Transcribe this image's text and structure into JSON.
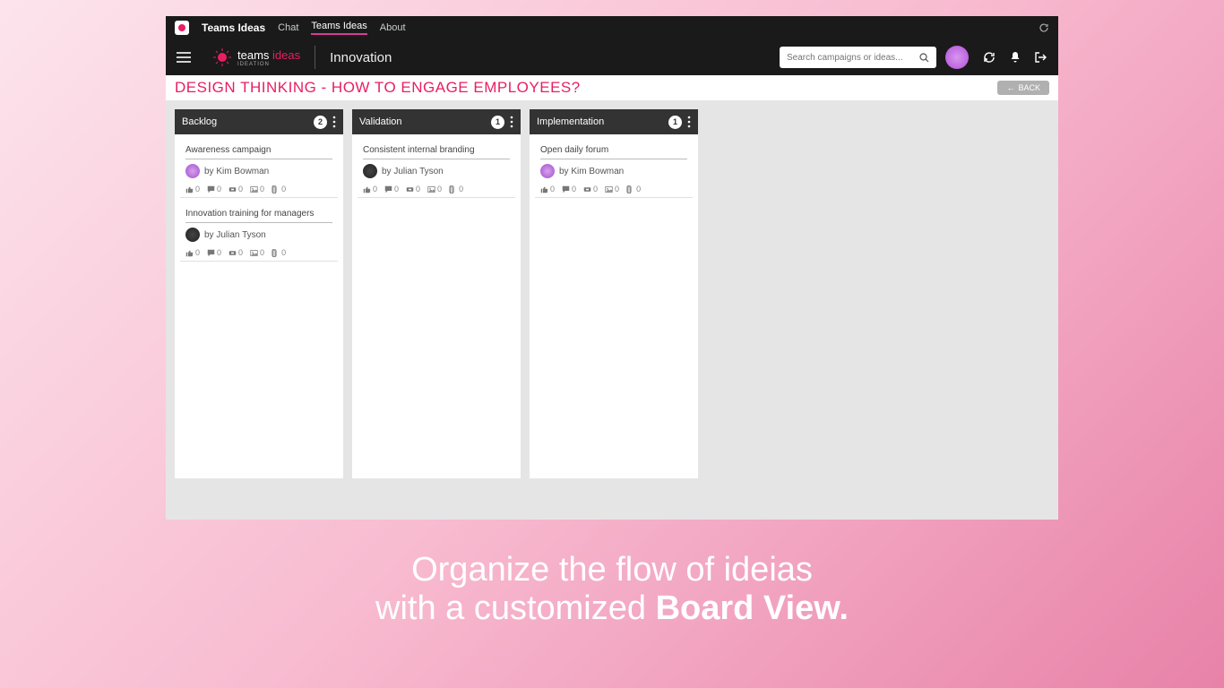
{
  "titlebar": {
    "app_title": "Teams Ideas",
    "tabs": [
      {
        "label": "Chat"
      },
      {
        "label": "Teams Ideas"
      },
      {
        "label": "About"
      }
    ]
  },
  "toolbar": {
    "logo_text_1": "teams ",
    "logo_text_2": "ideas",
    "logo_sub": "IDEATION",
    "page_name": "Innovation",
    "search_placeholder": "Search campaigns or ideas..."
  },
  "campaign": {
    "title": "DESIGN THINKING - HOW TO ENGAGE EMPLOYEES?",
    "back_label": "BACK"
  },
  "columns": [
    {
      "title": "Backlog",
      "count": "2",
      "cards": [
        {
          "title": "Awareness campaign",
          "author": "by Kim Bowman",
          "avatar": "kim",
          "likes": "0",
          "comments": "0",
          "votes": "0",
          "images": "0",
          "files": "0"
        },
        {
          "title": "Innovation training for managers",
          "author": "by Julian Tyson",
          "avatar": "julian",
          "likes": "0",
          "comments": "0",
          "votes": "0",
          "images": "0",
          "files": "0"
        }
      ]
    },
    {
      "title": "Validation",
      "count": "1",
      "cards": [
        {
          "title": "Consistent internal branding",
          "author": "by Julian Tyson",
          "avatar": "julian",
          "likes": "0",
          "comments": "0",
          "votes": "0",
          "images": "0",
          "files": "0"
        }
      ]
    },
    {
      "title": "Implementation",
      "count": "1",
      "cards": [
        {
          "title": "Open daily forum",
          "author": "by Kim Bowman",
          "avatar": "kim",
          "likes": "0",
          "comments": "0",
          "votes": "0",
          "images": "0",
          "files": "0"
        }
      ]
    }
  ],
  "marketing": {
    "line1": "Organize the flow of ideias",
    "line2_a": "with a customized ",
    "line2_b": "Board View."
  }
}
